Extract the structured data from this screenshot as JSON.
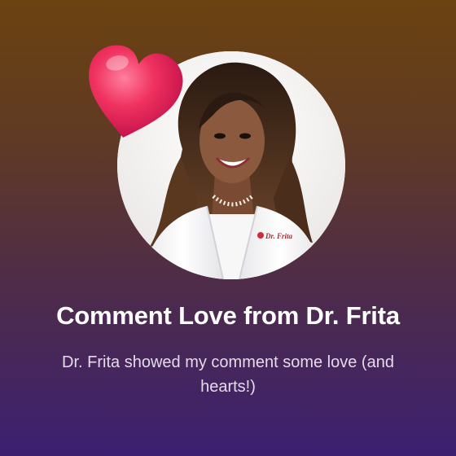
{
  "card": {
    "title": "Comment Love from Dr. Frita",
    "subtitle": "Dr. Frita showed my comment some love (and hearts!)",
    "profile_badge_text": "Dr. Frita",
    "icons": [
      "heart-icon"
    ],
    "colors": {
      "background_top": "#6b4210",
      "background_bottom": "#3c2071",
      "heart": "#e8245c",
      "text": "#ffffff"
    }
  }
}
